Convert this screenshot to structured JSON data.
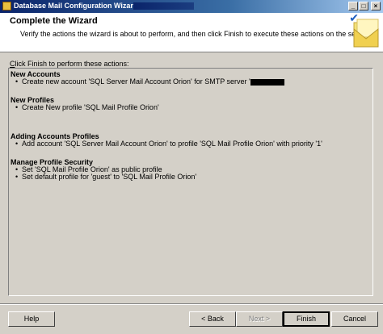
{
  "window": {
    "title": "Database Mail Configuration Wizard - L",
    "minimize": "_",
    "maximize": "□",
    "close": "×"
  },
  "header": {
    "title": "Complete the Wizard",
    "subtitle": "Verify the actions the wizard is about to perform, and then click Finish to execute these actions on the server."
  },
  "prompt": {
    "text_prefix": "",
    "underlined": "C",
    "text_rest": "lick Finish to perform these actions:"
  },
  "sections": [
    {
      "title": "New Accounts",
      "items": [
        "Create new account 'SQL Server Mail Account Orion' for SMTP server '"
      ]
    },
    {
      "title": "New Profiles",
      "items": [
        "Create New profile 'SQL Mail Profile Orion'"
      ]
    },
    {
      "title": "Adding Accounts Profiles",
      "items": [
        "Add account 'SQL Server Mail Account Orion' to profile 'SQL Mail Profile Orion' with priority '1'"
      ]
    },
    {
      "title": "Manage Profile Security",
      "items": [
        "Set 'SQL Mail Profile Orion' as public profile",
        "Set default profile for 'guest' to 'SQL Mail Profile Orion'"
      ]
    }
  ],
  "buttons": {
    "help": "Help",
    "back": "< Back",
    "next": "Next >",
    "finish": "Finish",
    "cancel": "Cancel"
  }
}
